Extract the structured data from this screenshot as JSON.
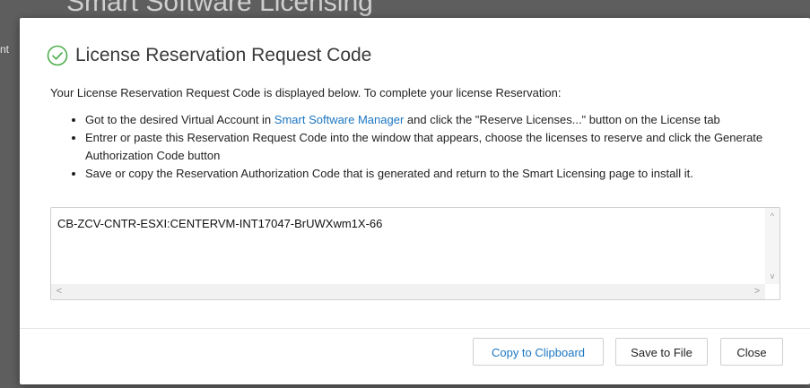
{
  "background": {
    "title": "Smart Software Licensing",
    "left_fragment": "nt"
  },
  "dialog": {
    "title": "License Reservation Request Code",
    "title_icon": "check-circle-icon",
    "accent_color": "#4cae4c",
    "intro": "Your License Reservation Request Code is displayed below. To complete your license Reservation:",
    "steps": {
      "step1_prefix": "Got to the desired Virtual Account in ",
      "step1_link": "Smart Software Manager",
      "step1_suffix": " and click the \"Reserve Licenses...\" button on the License tab",
      "step2": "Entrer or paste this Reservation Request Code into the window that appears, choose the licenses to reserve and click the Generate Authorization Code button",
      "step3": "Save or copy the Reservation Authorization Code that is generated and return to the Smart Licensing page to install it."
    },
    "request_code": "CB-ZCV-CNTR-ESXI:CENTERVM-INT17047-BrUWXwm1X-66",
    "scroll_up_glyph": "^",
    "scroll_down_glyph": "v",
    "scroll_left_glyph": "<",
    "scroll_right_glyph": ">",
    "buttons": {
      "copy": "Copy to Clipboard",
      "save": "Save to File",
      "close": "Close"
    },
    "link_color": "#1b76c2"
  }
}
